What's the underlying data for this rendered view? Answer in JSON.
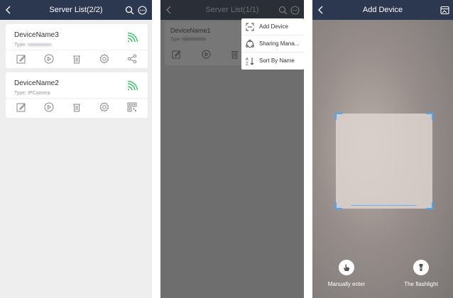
{
  "panel_server_list": {
    "title": "Server List(2/2)",
    "devices": [
      {
        "name": "DeviceName3",
        "type_label": "Type:",
        "type_value": ""
      },
      {
        "name": "DeviceName2",
        "type_label": "Type:",
        "type_value": "IPCamera"
      }
    ]
  },
  "panel_menu": {
    "title": "Server List(1/1)",
    "device": {
      "name": "DeviceName1",
      "type_label": "Type:"
    },
    "menu": [
      {
        "label": "Add Device",
        "icon": "scan-icon"
      },
      {
        "label": "Sharing Mana...",
        "icon": "share-manage-icon"
      },
      {
        "label": "Sort By Name",
        "icon": "sort-az-icon"
      }
    ]
  },
  "panel_add_device": {
    "title": "Add Device",
    "manual_label": "Manually enter",
    "flashlight_label": "The flashlight"
  },
  "colors": {
    "navbar": "#2c3750",
    "online": "#3cc26a",
    "scan_corner": "#4aa8ff"
  }
}
